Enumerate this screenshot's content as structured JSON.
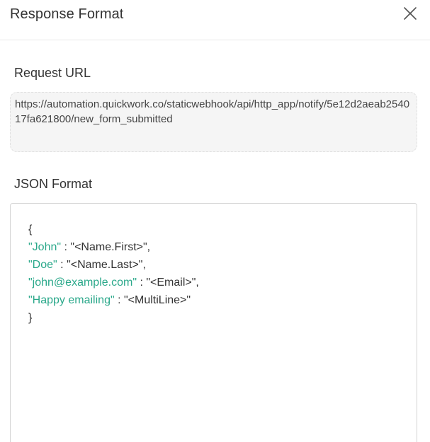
{
  "modal": {
    "title": "Response Format",
    "close_icon": "close-icon"
  },
  "request_url": {
    "label": "Request URL",
    "value": "https://automation.quickwork.co/staticwebhook/api/http_app/notify/5e12d2aeab254017fa621800/new_form_submitted"
  },
  "json_format": {
    "label": "JSON Format",
    "open_brace": "{",
    "close_brace": "}",
    "entries": [
      {
        "key": "\"John\"",
        "sep": " : ",
        "value": "\"<Name.First>\","
      },
      {
        "key": "\"Doe\"",
        "sep": " : ",
        "value": "\"<Name.Last>\","
      },
      {
        "key": "\"john@example.com\"",
        "sep": " : ",
        "value": "\"<Email>\","
      },
      {
        "key": "\"Happy emailing\"",
        "sep": " : ",
        "value": "\"<MultiLine>\""
      }
    ],
    "key_color": "#2aa88a"
  }
}
